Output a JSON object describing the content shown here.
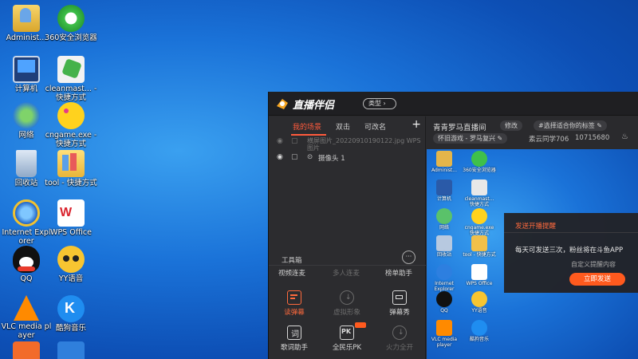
{
  "desktop": {
    "icons": [
      {
        "label": "Administ...",
        "icon": "user-folder-icon"
      },
      {
        "label": "360安全浏览器",
        "icon": "browser-360-icon"
      },
      {
        "label": "计算机",
        "icon": "computer-icon"
      },
      {
        "label": "cleanmast... - 快捷方式",
        "icon": "broom-icon"
      },
      {
        "label": "网络",
        "icon": "network-icon"
      },
      {
        "label": "cngame.exe - 快捷方式",
        "icon": "pacman-icon"
      },
      {
        "label": "回收站",
        "icon": "recycle-bin-icon"
      },
      {
        "label": "tool - 快捷方式",
        "icon": "folder-icon"
      },
      {
        "label": "Internet Explorer",
        "icon": "ie-icon"
      },
      {
        "label": "WPS Office",
        "icon": "wps-icon"
      },
      {
        "label": "QQ",
        "icon": "qq-penguin-icon"
      },
      {
        "label": "YY语音",
        "icon": "yy-icon"
      },
      {
        "label": "VLC media player",
        "icon": "vlc-cone-icon"
      },
      {
        "label": "酷狗音乐",
        "icon": "kugou-icon"
      },
      {
        "label": "",
        "icon": "bird-icon"
      },
      {
        "label": "",
        "icon": "swallow-icon"
      }
    ]
  },
  "app": {
    "title": "直播伴侣",
    "mode_label": "类型",
    "tabs": [
      "我的场景",
      "双击",
      "可改名"
    ],
    "active_tab": 0,
    "add_label": "+",
    "sources": [
      {
        "type_label": "",
        "name": "横屏图片_20220910190122.jpg WPS图片",
        "dim": true
      },
      {
        "type_label": "摄像头 1",
        "name": "",
        "dim": false
      }
    ],
    "tools_title": "工具箱",
    "tools_more": "···",
    "tools_row_labels": [
      "视频连麦",
      "多人连麦",
      "榜单助手"
    ],
    "tools": [
      {
        "label": "读弹幕",
        "icon": "danmu-reader-icon",
        "state": "hot"
      },
      {
        "label": "虚拟形象",
        "icon": "download-icon",
        "state": "dim"
      },
      {
        "label": "弹幕秀",
        "icon": "tv-icon",
        "state": "normal"
      },
      {
        "label": "歌词助手",
        "icon": "lyrics-icon",
        "state": "normal"
      },
      {
        "label": "全民乐PK",
        "icon": "pk-icon",
        "state": "normal",
        "badge": "NEW"
      },
      {
        "label": "火力全开",
        "icon": "download-icon",
        "state": "dim"
      }
    ],
    "room": {
      "title": "青青罗马直播间",
      "edit_label": "修改",
      "tag_label": "#选择适合你的标签",
      "category": "怀旧游戏 - 罗马复兴",
      "author": "素云同学706",
      "room_id": "10715680",
      "heat_icon": "flame-icon"
    },
    "preview_icons": [
      "Administ...",
      "360安全浏览器",
      "计算机",
      "cleanmast... 快捷方式",
      "网络",
      "cngame.exe 快捷方式",
      "回收站",
      "tool - 快捷方式",
      "Internet Explorer",
      "WPS Office",
      "QQ",
      "YY语音",
      "VLC media player",
      "酷狗音乐"
    ],
    "notify": {
      "title": "发送开播提醒",
      "message": "每天可发送三次，粉丝将在斗鱼APP",
      "custom_label": "自定义提醒内容",
      "button_label": "立即发送"
    }
  },
  "colors": {
    "accent": "#ff5a1e",
    "window_bg": "#2a2a2d",
    "desktop_blue": "#1a72d8"
  }
}
